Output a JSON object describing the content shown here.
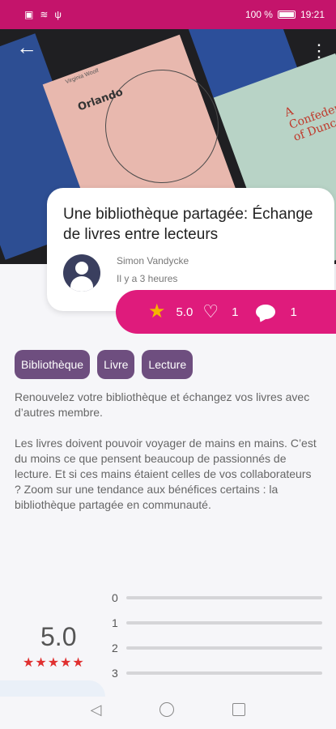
{
  "status": {
    "battery": "100 %",
    "time": "19:21",
    "left_icons": [
      "sim-icon",
      "wifi-icon",
      "usb-icon"
    ]
  },
  "cover": {
    "book_title": "Orlando",
    "book_author": "Virginia Woolf",
    "book2_title": "A Confederacy of Dunces"
  },
  "post": {
    "title": "Une bibliothèque partagée: Échange de livres entre lecteurs",
    "author": "Simon Vandycke",
    "time": "Il y a 3 heures"
  },
  "stats": {
    "rating": "5.0",
    "likes": "1",
    "comments": "1"
  },
  "tags": [
    "Bibliothèque",
    "Livre",
    "Lecture"
  ],
  "body": {
    "intro": "Renouvelez votre bibliothèque et échangez vos livres avec d’autres membre.",
    "paragraph": "Les livres doivent pouvoir voyager de mains en mains. C’est du moins ce que pensent beaucoup de passionnés de lecture. Et si ces mains étaient celles de vos collaborateurs ? Zoom sur une tendance aux bénéfices certains : la bibliothèque partagée en communauté."
  },
  "rating_summary": {
    "average": "5.0",
    "stars": "★★★★★",
    "bars": [
      {
        "label": "0",
        "fill": 0
      },
      {
        "label": "1",
        "fill": 0
      },
      {
        "label": "2",
        "fill": 0
      },
      {
        "label": "3",
        "fill": 0
      }
    ]
  },
  "colors": {
    "status_bar": "#c4146b",
    "stats_bar": "#df1b7c",
    "tag": "#6e4e7f",
    "star": "#f5b400",
    "rating_star": "#e03030"
  }
}
